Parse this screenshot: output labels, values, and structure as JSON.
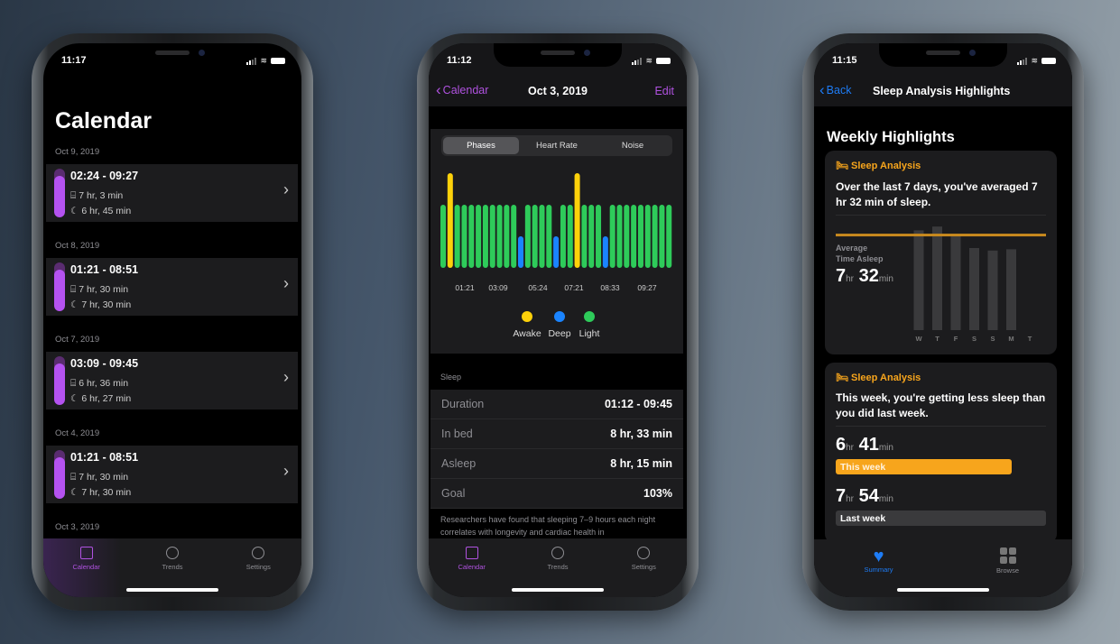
{
  "colors": {
    "purple": "#b452f0",
    "awake": "#fdd10a",
    "deep": "#1a84ff",
    "light": "#2ecb5a",
    "orange": "#f7a51c",
    "blue": "#1e7cf5"
  },
  "phone1": {
    "status_time": "11:17",
    "title": "Calendar",
    "entries": [
      {
        "date": "Oct 9, 2019",
        "range": "02:24 - 09:27",
        "in_bed": "7 hr, 3 min",
        "asleep": "6 hr, 45 min"
      },
      {
        "date": "Oct 8, 2019",
        "range": "01:21 - 08:51",
        "in_bed": "7 hr, 30 min",
        "asleep": "7 hr, 30 min"
      },
      {
        "date": "Oct 7, 2019",
        "range": "03:09 - 09:45",
        "in_bed": "6 hr, 36 min",
        "asleep": "6 hr, 27 min"
      },
      {
        "date": "Oct 4, 2019",
        "range": "01:21 - 08:51",
        "in_bed": "7 hr, 30 min",
        "asleep": "7 hr, 30 min"
      },
      {
        "date": "Oct 3, 2019"
      }
    ],
    "tabs": [
      "Calendar",
      "Trends",
      "Settings"
    ]
  },
  "phone2": {
    "status_time": "11:12",
    "back_label": "Calendar",
    "title": "Oct 3, 2019",
    "edit_label": "Edit",
    "segments": [
      "Phases",
      "Heart Rate",
      "Noise"
    ],
    "chart_data": {
      "type": "bar",
      "phases": [
        "light",
        "awake",
        "light",
        "light",
        "light",
        "light",
        "light",
        "light",
        "light",
        "light",
        "light",
        "deep",
        "light",
        "light",
        "light",
        "light",
        "deep",
        "light",
        "light",
        "awake",
        "light",
        "light",
        "light",
        "deep",
        "light",
        "light",
        "light",
        "light",
        "light",
        "light",
        "light",
        "light",
        "light"
      ],
      "x_tick_labels": [
        "01:21",
        "03:09",
        "05:24",
        "07:21",
        "08:33",
        "09:27"
      ],
      "legend": [
        {
          "name": "Awake",
          "key": "awake"
        },
        {
          "name": "Deep",
          "key": "deep"
        },
        {
          "name": "Light",
          "key": "light"
        }
      ]
    },
    "section_label": "Sleep",
    "rows": [
      {
        "label": "Duration",
        "value": "01:12 - 09:45"
      },
      {
        "label": "In bed",
        "value": "8 hr, 33 min"
      },
      {
        "label": "Asleep",
        "value": "8 hr, 15 min"
      },
      {
        "label": "Goal",
        "value": "103%"
      }
    ],
    "description": "Researchers have found that sleeping 7–9 hours each night correlates with longevity and cardiac health in",
    "tabs": [
      "Calendar",
      "Trends",
      "Settings"
    ]
  },
  "phone3": {
    "status_time": "11:15",
    "back_label": "Back",
    "title": "Sleep Analysis Highlights",
    "heading": "Weekly Highlights",
    "card1": {
      "tag": "Sleep Analysis",
      "text": "Over the last 7 days, you've averaged 7 hr 32 min of sleep.",
      "avg_label_1": "Average",
      "avg_label_2": "Time Asleep",
      "avg_hr": "7",
      "avg_min": "32",
      "hr_unit": "hr",
      "min_unit": "min",
      "chart_data": {
        "type": "bar",
        "categories": [
          "W",
          "T",
          "F",
          "S",
          "S",
          "M",
          "T"
        ],
        "values_hours": [
          7.9,
          8.2,
          7.6,
          6.5,
          6.3,
          6.4,
          null
        ],
        "average_hours": 7.53
      }
    },
    "card2": {
      "tag": "Sleep Analysis",
      "text": "This week, you're getting less sleep than you did last week.",
      "this_hr": "6",
      "this_min": "41",
      "this_label": "This week",
      "last_hr": "7",
      "last_min": "54",
      "last_label": "Last week",
      "hr_unit": "hr",
      "min_unit": "min"
    },
    "tabs": [
      "Summary",
      "Browse"
    ]
  }
}
